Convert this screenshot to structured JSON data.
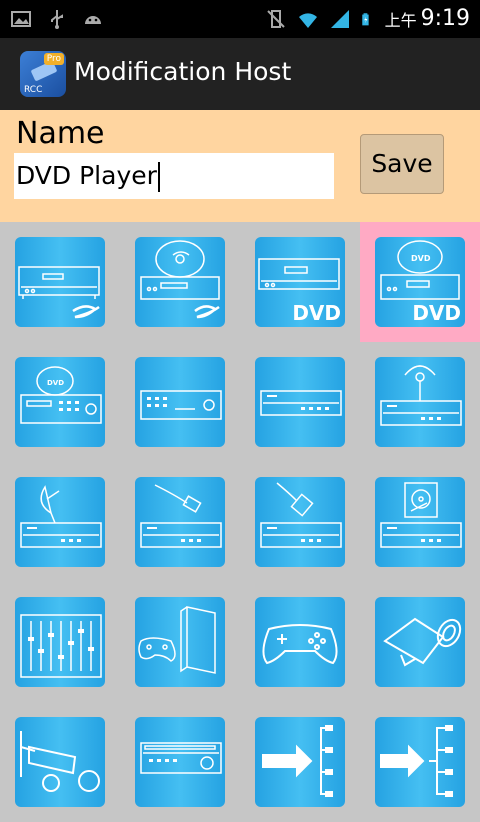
{
  "status_bar": {
    "ampm": "上午",
    "time": "9:19"
  },
  "action_bar": {
    "title": "Modification Host",
    "app_icon_badge": "Pro",
    "app_icon_text": "RCC"
  },
  "form": {
    "name_label": "Name",
    "name_value": "DVD Player",
    "save_label": "Save"
  },
  "grid": {
    "selected_index": 3,
    "dvd_badge": "DVD",
    "icons": [
      "bluray-player-icon",
      "bluray-disc-player-icon",
      "dvd-recorder-icon",
      "dvd-player-icon",
      "dvd-keypad-player-icon",
      "av-receiver-icon",
      "power-deck-icon",
      "wireless-receiver-icon",
      "satellite-receiver-icon",
      "cable-box-icon",
      "network-box-icon",
      "hdd-recorder-icon",
      "audio-mixer-icon",
      "game-console-tower-icon",
      "gamepad-icon",
      "camcorder-icon",
      "security-camera-icon",
      "amplifier-icon",
      "output-switch-icon",
      "input-switch-icon"
    ]
  },
  "colors": {
    "tile_blue": "#30aee8",
    "form_bg": "#ffd5a0",
    "selected_bg": "#ffaac4",
    "grid_bg": "#c6c6c6"
  }
}
